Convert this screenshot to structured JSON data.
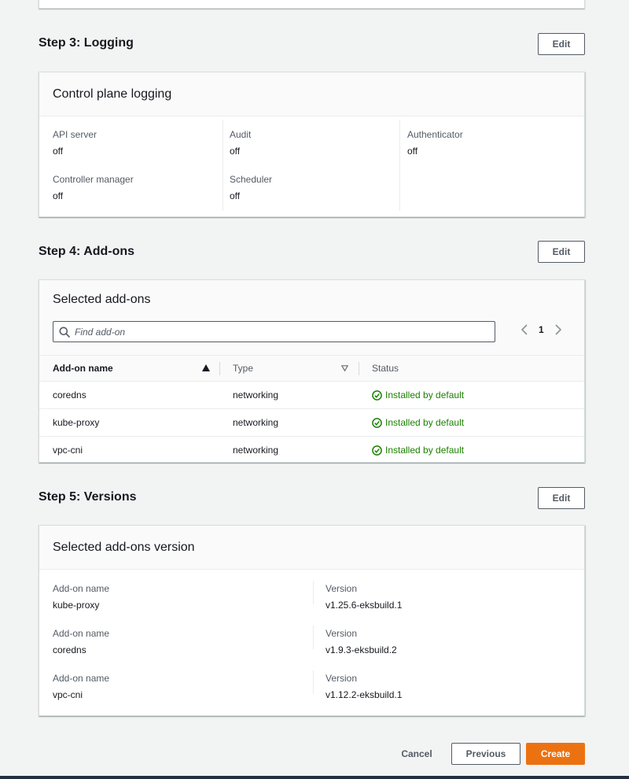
{
  "step3": {
    "title": "Step 3: Logging",
    "edit_label": "Edit",
    "card_title": "Control plane logging",
    "items": [
      {
        "label": "API server",
        "value": "off"
      },
      {
        "label": "Audit",
        "value": "off"
      },
      {
        "label": "Authenticator",
        "value": "off"
      },
      {
        "label": "Controller manager",
        "value": "off"
      },
      {
        "label": "Scheduler",
        "value": "off"
      }
    ]
  },
  "step4": {
    "title": "Step 4: Add-ons",
    "edit_label": "Edit",
    "card_title": "Selected add-ons",
    "search_placeholder": "Find add-on",
    "page": "1",
    "columns": [
      "Add-on name",
      "Type",
      "Status"
    ],
    "rows": [
      {
        "name": "coredns",
        "type": "networking",
        "status": "Installed by default"
      },
      {
        "name": "kube-proxy",
        "type": "networking",
        "status": "Installed by default"
      },
      {
        "name": "vpc-cni",
        "type": "networking",
        "status": "Installed by default"
      }
    ]
  },
  "step5": {
    "title": "Step 5: Versions",
    "edit_label": "Edit",
    "card_title": "Selected add-ons version",
    "name_label": "Add-on name",
    "version_label": "Version",
    "rows": [
      {
        "name": "kube-proxy",
        "version": "v1.25.6-eksbuild.1"
      },
      {
        "name": "coredns",
        "version": "v1.9.3-eksbuild.2"
      },
      {
        "name": "vpc-cni",
        "version": "v1.12.2-eksbuild.1"
      }
    ]
  },
  "footer": {
    "cancel_label": "Cancel",
    "previous_label": "Previous",
    "create_label": "Create"
  },
  "colors": {
    "background": "#f2f3f3",
    "primary_button": "#ec7211",
    "success": "#1d8102",
    "text": "#16191f",
    "secondary_text": "#545b64"
  }
}
